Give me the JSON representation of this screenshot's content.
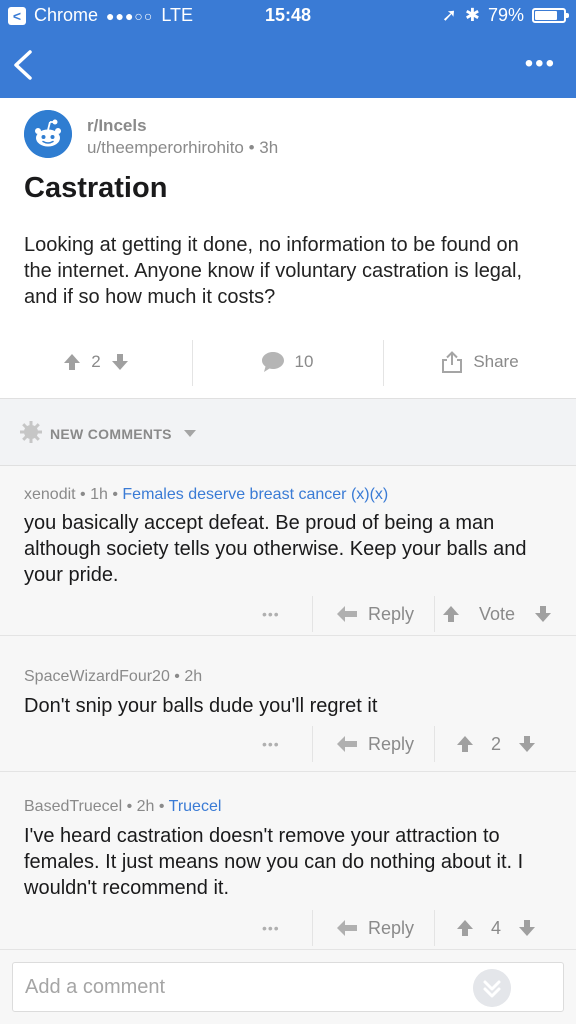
{
  "status_bar": {
    "back_app": "Chrome",
    "signal": "●●●○○",
    "network": "LTE",
    "time": "15:48",
    "battery": "79%",
    "battery_level": 0.79
  },
  "post": {
    "subreddit": "r/Incels",
    "author": "u/theemperorhirohito",
    "age": "3h",
    "title": "Castration",
    "body": "Looking at getting it done, no information to be found on the internet. Anyone know if voluntary castration is legal, and if so how much it costs?",
    "score": "2",
    "comments": "10",
    "share": "Share"
  },
  "section": {
    "label": "NEW COMMENTS"
  },
  "comments": [
    {
      "author": "xenodit",
      "age": "1h",
      "flair": "Females deserve breast cancer (x)(x)",
      "body": "you basically accept defeat. Be proud of being a man although society tells you otherwise. Keep your balls and your pride.",
      "reply": "Reply",
      "score": "Vote"
    },
    {
      "author": "SpaceWizardFour20",
      "age": "2h",
      "flair": "",
      "body": "Don't snip your balls dude you'll regret it",
      "reply": "Reply",
      "score": "2"
    },
    {
      "author": "BasedTruecel",
      "age": "2h",
      "flair": "Truecel",
      "body": "I've heard castration doesn't remove your attraction to females. It just means now you can do nothing about it. I wouldn't recommend it.",
      "reply": "Reply",
      "score": "4"
    }
  ],
  "composer": {
    "placeholder": "Add a comment"
  },
  "colors": {
    "header": "#3a7bd5",
    "flair": "#3a7bd5",
    "avatar": "#2f7dd1"
  },
  "icons": [
    "back-arrow-icon",
    "more-icon",
    "reddit-alien-icon",
    "upvote-icon",
    "downvote-icon",
    "comment-bubble-icon",
    "share-icon",
    "gear-icon",
    "reply-arrow-icon",
    "send-icon"
  ]
}
